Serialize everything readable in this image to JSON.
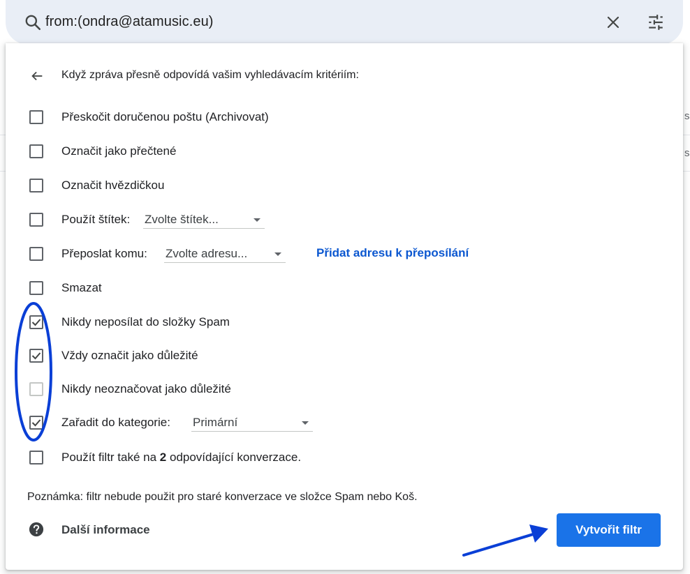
{
  "search": {
    "query": "from:(ondra@atamusic.eu)",
    "search_icon": "search-icon",
    "clear_icon": "close-icon",
    "options_icon": "tune-icon"
  },
  "filter_panel": {
    "heading": "Když zpráva přesně odpovídá vašim vyhledávacím kritériím:",
    "options": [
      {
        "label": "Přeskočit doručenou poštu (Archivovat)",
        "checked": false
      },
      {
        "label": "Označit jako přečtené",
        "checked": false
      },
      {
        "label": "Označit hvězdičkou",
        "checked": false
      },
      {
        "label": "Použít štítek:",
        "checked": false,
        "select_value": "Zvolte štítek..."
      },
      {
        "label": "Přeposlat komu:",
        "checked": false,
        "select_value": "Zvolte adresu...",
        "link": "Přidat adresu k přeposílání"
      },
      {
        "label": "Smazat",
        "checked": false
      },
      {
        "label": "Nikdy neposílat do složky Spam",
        "checked": true
      },
      {
        "label": "Vždy označit jako důležité",
        "checked": true
      },
      {
        "label": "Nikdy neoznačovat jako důležité",
        "checked": false,
        "disabled": true
      },
      {
        "label": "Zařadit do kategorie:",
        "checked": true,
        "select_value": "Primární"
      }
    ],
    "apply_existing": {
      "prefix": "Použít filtr také na ",
      "count": "2",
      "suffix": " odpovídající konverzace.",
      "checked": false
    },
    "note": "Poznámka: filtr nebude použit pro staré konverzace ve složce Spam nebo Koš.",
    "more_info": "Další informace",
    "create_button": "Vytvořit filtr"
  },
  "background": {
    "edge_letters": [
      "s",
      "s"
    ]
  },
  "colors": {
    "accent": "#1a73e8",
    "link": "#0b57d0",
    "annotation": "#0a3fd6",
    "search_bg": "#e9eef6"
  }
}
